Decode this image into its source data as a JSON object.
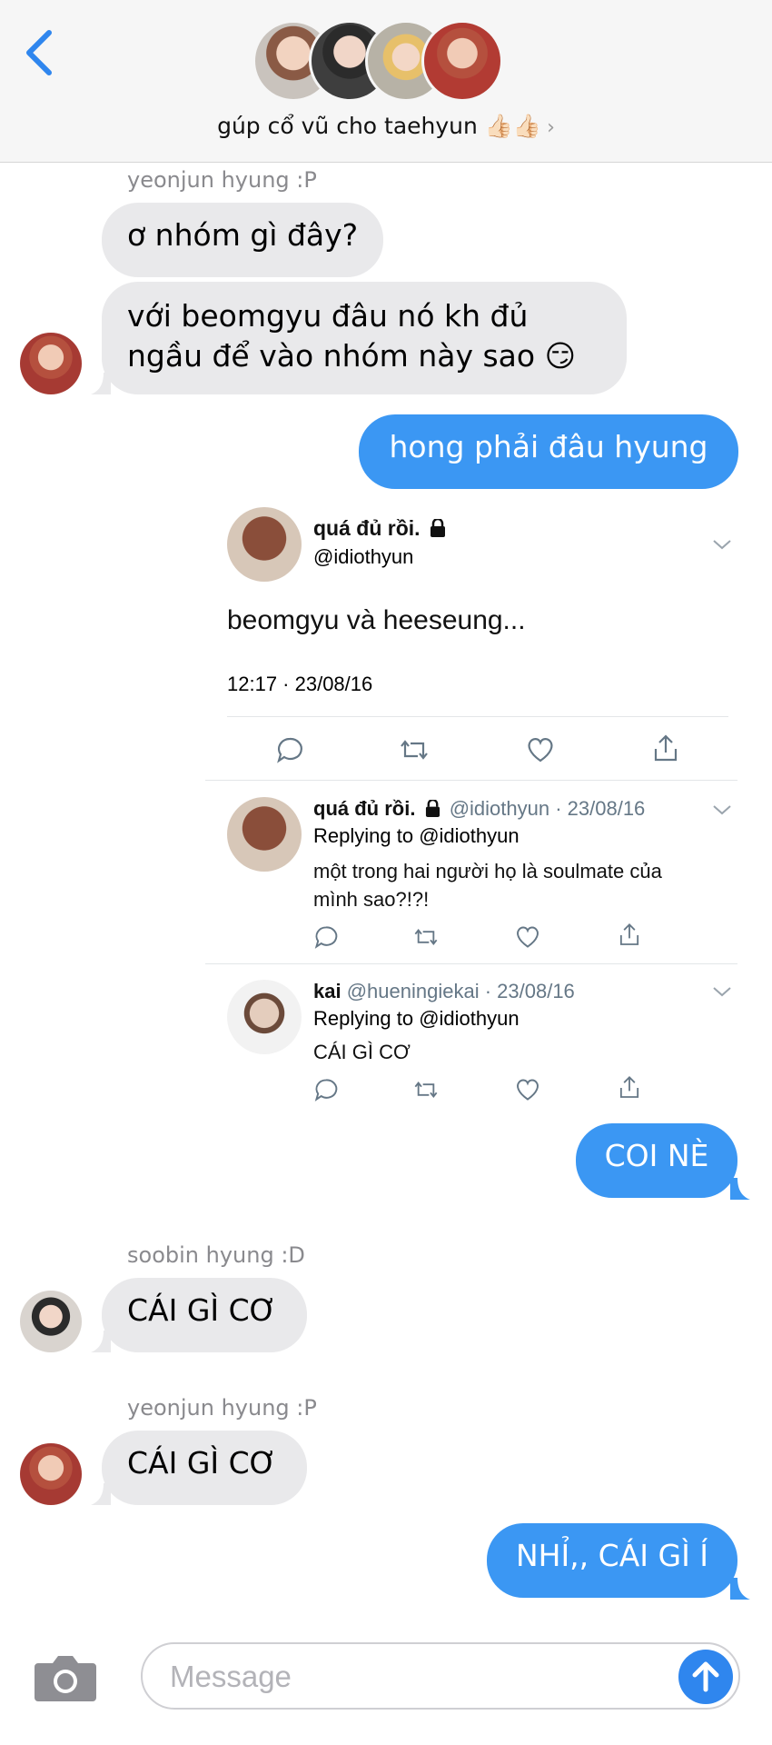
{
  "header": {
    "group_name": "gúp cổ vũ cho taehyun 👍🏻👍🏻",
    "chevron": "›",
    "back_icon": "chevron-left-icon"
  },
  "messages": [
    {
      "sender": "yeonjun hyung :P",
      "text": "ơ nhóm gì đây?"
    },
    {
      "text_line1": "với beomgyu đâu nó kh đủ",
      "text_line2": "ngầu để vào nhóm này sao 😏"
    },
    {
      "text": "hong phải đâu hyung"
    },
    {
      "text": "COI NÈ"
    },
    {
      "sender": "soobin hyung :D",
      "text": "CÁI GÌ CƠ"
    },
    {
      "sender": "yeonjun hyung :P",
      "text": "CÁI GÌ CƠ"
    },
    {
      "text": "NHỈ,, CÁI GÌ Í"
    }
  ],
  "tweet_main": {
    "name": "quá đủ rồi.",
    "handle": "@idiothyun",
    "text": "beomgyu và heeseung...",
    "time": "12:17 · 23/08/16"
  },
  "tweet_reply1": {
    "name": "quá đủ rồi.",
    "handle_time": "@idiothyun · 23/08/16",
    "replying": "Replying to",
    "replying_to": "@idiothyun",
    "text_line1": "một trong hai người họ là soulmate của",
    "text_line2": "mình sao?!?!"
  },
  "tweet_reply2": {
    "name": "kai",
    "handle_time": "@hueningiekai · 23/08/16",
    "replying": "Replying to",
    "replying_to": "@idiothyun",
    "text": "CÁI GÌ CƠ"
  },
  "composer": {
    "placeholder": "Message"
  },
  "colors": {
    "outgoing": "#3b97f3",
    "incoming": "#e9e9eb",
    "accent": "#2f86ee",
    "link": "#1da1f2"
  }
}
